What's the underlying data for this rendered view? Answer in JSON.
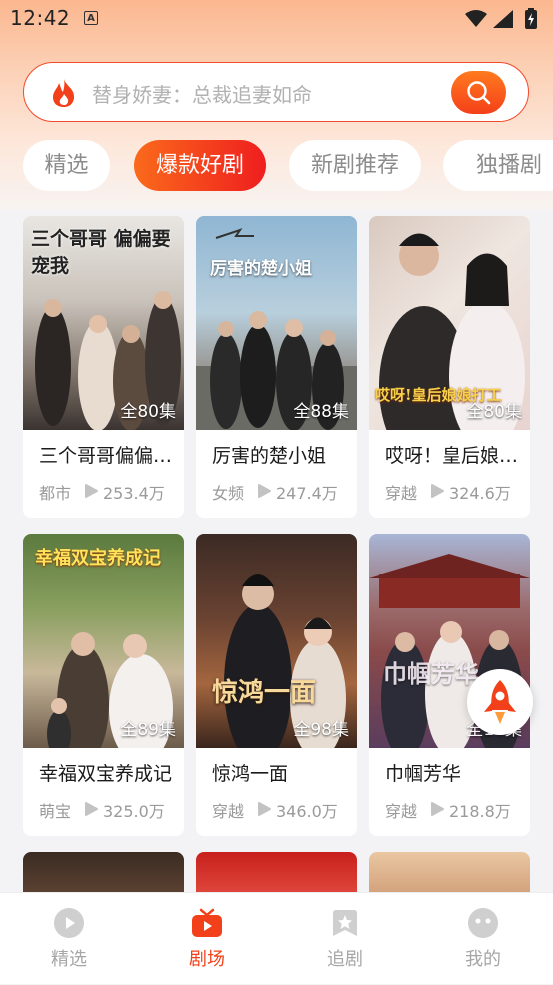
{
  "status_bar": {
    "time": "12:42",
    "notification_icon": "A"
  },
  "search": {
    "placeholder": "替身娇妻：总裁追妻如命"
  },
  "tabs": [
    {
      "label": "精选",
      "active": false
    },
    {
      "label": "爆款好剧",
      "active": true
    },
    {
      "label": "新剧推荐",
      "active": false
    },
    {
      "label": "独播剧",
      "active": false
    }
  ],
  "dramas": [
    {
      "title": "三个哥哥偏偏要宠我",
      "poster_text": "三个哥哥 偏偏要宠我",
      "episodes": "全80集",
      "category": "都市",
      "views": "253.4万"
    },
    {
      "title": "厉害的楚小姐",
      "poster_text": "厉害的楚小姐",
      "episodes": "全88集",
      "category": "女频",
      "views": "247.4万"
    },
    {
      "title": "哎呀！皇后娘娘打工记",
      "poster_text": "哎呀!皇后娘娘打工",
      "episodes": "全80集",
      "category": "穿越",
      "views": "324.6万"
    },
    {
      "title": "幸福双宝养成记",
      "poster_text": "幸福双宝养成记",
      "episodes": "全89集",
      "category": "萌宝",
      "views": "325.0万"
    },
    {
      "title": "惊鸿一面",
      "poster_text": "惊鸿一面",
      "episodes": "全98集",
      "category": "穿越",
      "views": "346.0万"
    },
    {
      "title": "巾帼芳华",
      "poster_text": "巾帼芳华",
      "episodes": "全10集",
      "category": "穿越",
      "views": "218.8万"
    }
  ],
  "bottom_nav": [
    {
      "label": "精选",
      "icon": "play-circle-icon",
      "active": false
    },
    {
      "label": "剧场",
      "icon": "tv-icon",
      "active": true
    },
    {
      "label": "追剧",
      "icon": "star-bookmark-icon",
      "active": false
    },
    {
      "label": "我的",
      "icon": "face-icon",
      "active": false
    }
  ],
  "colors": {
    "accent": "#f2401a",
    "accent_light": "#fa6a1c",
    "muted": "#9a9a9a"
  }
}
